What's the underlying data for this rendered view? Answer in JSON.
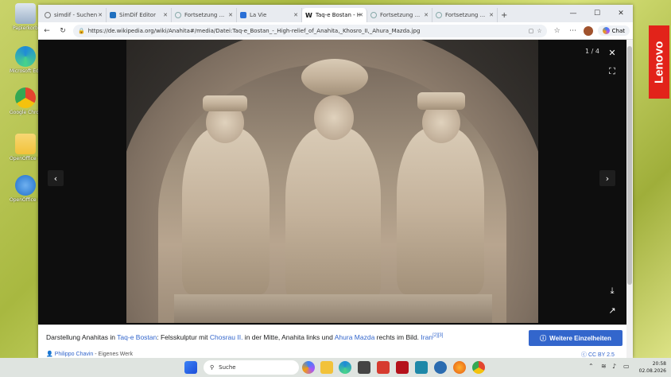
{
  "desktop": {
    "icons": [
      {
        "label": "Papierkorb",
        "color": "#9bb0c8"
      },
      {
        "label": "Microsoft Edge",
        "color": "#1f8ad8"
      },
      {
        "label": "Google Chrome",
        "color": "#e3452f"
      },
      {
        "label": "OpenOffice 4.1 (de) Installation",
        "color": "#f2c23a"
      },
      {
        "label": "OpenOffice 4.1",
        "color": "#1e6fc9"
      }
    ],
    "brand": "Lenovo"
  },
  "browser": {
    "tabs": [
      {
        "label": "simdif - Suchen",
        "active": false,
        "fav_color": "#777"
      },
      {
        "label": "SimDif Editor",
        "active": false,
        "fav_color": "#1f6fbf"
      },
      {
        "label": "Fortsetzung ...",
        "active": false,
        "fav_color": "#8aa"
      },
      {
        "label": "La Vie",
        "active": false,
        "fav_color": "#2a6fd6"
      },
      {
        "label": "Taq-e Bostan - High",
        "active": true,
        "fav_color": "#222"
      },
      {
        "label": "Fortsetzung ...",
        "active": false,
        "fav_color": "#8aa"
      },
      {
        "label": "Fortsetzung ...",
        "active": false,
        "fav_color": "#8aa"
      }
    ],
    "new_tab": "+",
    "window_controls": {
      "minimize": "—",
      "maximize": "☐",
      "close": "✕"
    },
    "url": "https://de.wikipedia.org/wiki/Anahita#/media/Datei:Taq-e_Bostan_-_High-relief_of_Anahita,_Khosro_II,_Ahura_Mazda.jpg",
    "chat_label": "Chat"
  },
  "viewer": {
    "counter": "1 / 4",
    "close": "✕",
    "fullscreen": "⛶",
    "prev": "‹",
    "next": "›",
    "download": "⤓",
    "share": "↗"
  },
  "caption": {
    "t1": "Darstellung Anahitas in ",
    "l1": "Taq-e Bostan",
    "t2": ": Felsskulptur mit ",
    "l2": "Chosrau II.",
    "t3": " in der Mitte, Anahita links und ",
    "l3": "Ahura Mazda",
    "t4": " rechts im Bild. ",
    "l4": "Iran",
    "ref": "[2][3]",
    "author": "Philippo Chavin",
    "work": " - Eigenes Werk",
    "more_button": "Weitere Einzelheiten",
    "license": "CC BY 2.5"
  },
  "taskbar": {
    "search_placeholder": "Suche",
    "time": "20:58",
    "date": "02.08.2026"
  }
}
